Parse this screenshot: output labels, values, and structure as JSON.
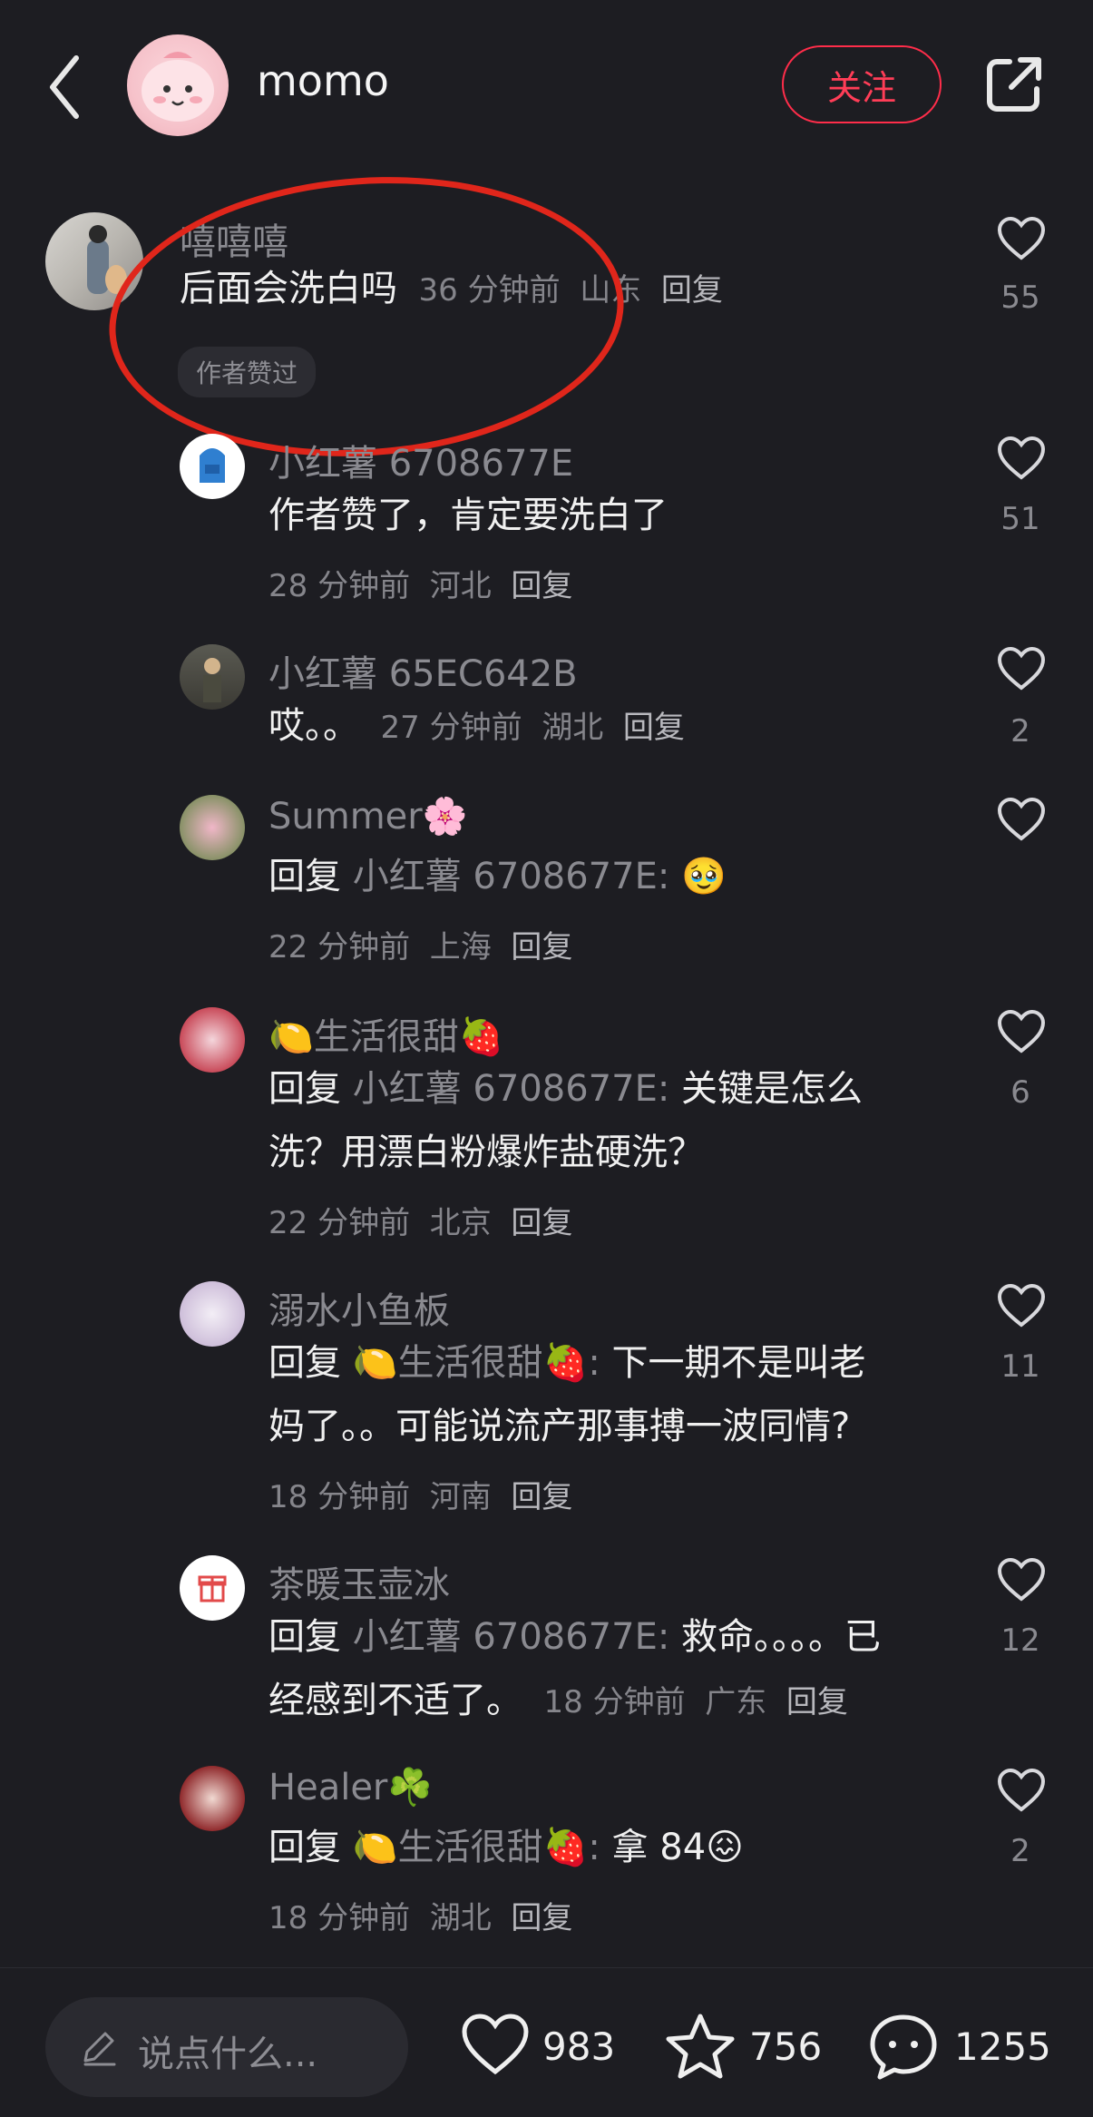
{
  "header": {
    "author_name": "momo",
    "follow_label": "关注"
  },
  "main_comment": {
    "username": "嘻嘻嘻",
    "text": "后面会洗白吗",
    "time": "36 分钟前",
    "location": "山东",
    "reply_label": "回复",
    "badge": "作者赞过",
    "likes": "55"
  },
  "replies": [
    {
      "username": "小红薯 6708677E",
      "lines": [
        "作者赞了，肯定要洗白了"
      ],
      "time": "28 分钟前",
      "location": "河北",
      "reply_label": "回复",
      "likes": "51"
    },
    {
      "username": "小红薯 65EC642B",
      "lines": [
        "哎。。"
      ],
      "time": "27 分钟前",
      "location": "湖北",
      "reply_label": "回复",
      "likes": "2"
    },
    {
      "username": "Summer🌸",
      "reply_prefix": "回复",
      "reply_to": "小红薯 6708677E:",
      "lines": [
        "🥹"
      ],
      "time": "22 分钟前",
      "location": "上海",
      "reply_label": "回复",
      "likes": ""
    },
    {
      "username": "🍋生活很甜🍓",
      "reply_prefix": "回复",
      "reply_to": "小红薯 6708677E:",
      "lines": [
        "关键是怎么",
        "洗？用漂白粉爆炸盐硬洗？"
      ],
      "time": "22 分钟前",
      "location": "北京",
      "reply_label": "回复",
      "likes": "6"
    },
    {
      "username": "溺水小鱼板",
      "reply_prefix": "回复",
      "reply_to": "🍋生活很甜🍓:",
      "lines": [
        "下一期不是叫老",
        "妈了。。可能说流产那事搏一波同情?"
      ],
      "time": "18 分钟前",
      "location": "河南",
      "reply_label": "回复",
      "likes": "11"
    },
    {
      "username": "茶暖玉壶冰",
      "reply_prefix": "回复",
      "reply_to": "小红薯 6708677E:",
      "lines": [
        "救命。。。。已",
        "经感到不适了。"
      ],
      "time": "18 分钟前",
      "location": "广东",
      "reply_label": "回复",
      "likes": "12"
    },
    {
      "username": "Healer☘️",
      "reply_prefix": "回复",
      "reply_to": "🍋生活很甜🍓:",
      "lines": [
        "拿 84😖"
      ],
      "time": "18 分钟前",
      "location": "湖北",
      "reply_label": "回复",
      "likes": "2"
    }
  ],
  "bottom_bar": {
    "input_placeholder": "说点什么...",
    "like_count": "983",
    "star_count": "756",
    "comment_count": "1255"
  },
  "colors": {
    "background": "#1d1d22",
    "accent": "#ff2d4a",
    "annotation": "#e0261b"
  },
  "icons": [
    "back-icon",
    "share-icon",
    "heart-icon",
    "star-icon",
    "chat-icon",
    "pencil-icon"
  ]
}
